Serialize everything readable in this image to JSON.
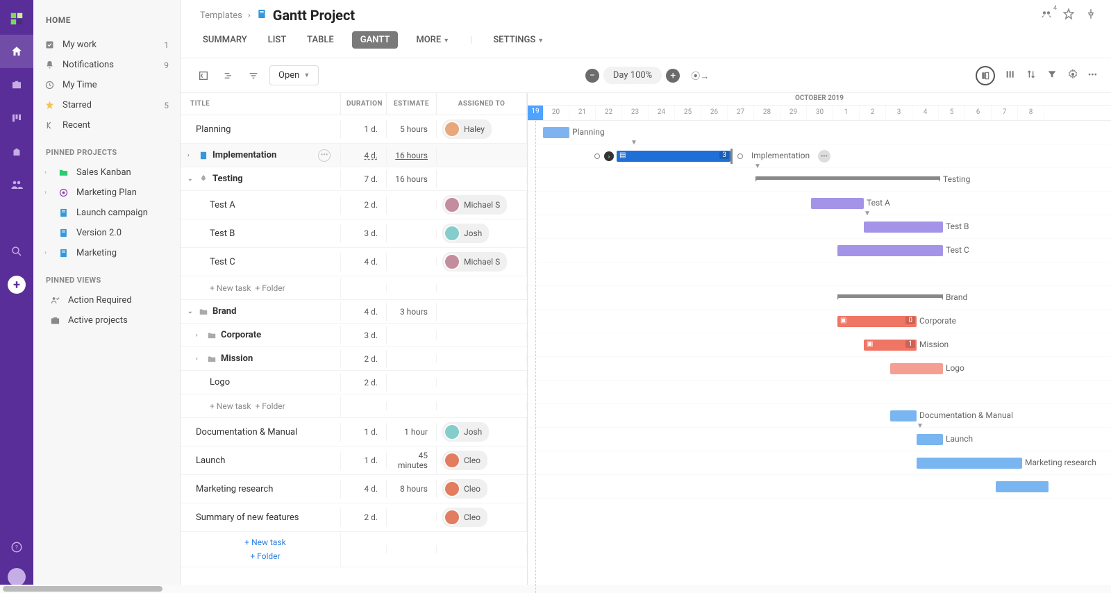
{
  "sidebar": {
    "title": "HOME",
    "nav": [
      {
        "icon": "check",
        "label": "My work",
        "count": "1"
      },
      {
        "icon": "bell",
        "label": "Notifications",
        "count": "9"
      },
      {
        "icon": "clock",
        "label": "My Time",
        "count": ""
      },
      {
        "icon": "star",
        "label": "Starred",
        "count": "5"
      },
      {
        "icon": "recent",
        "label": "Recent",
        "count": ""
      }
    ],
    "projects_label": "PINNED PROJECTS",
    "projects": [
      {
        "icon": "folder",
        "color": "green",
        "label": "Sales Kanban",
        "caret": true
      },
      {
        "icon": "target",
        "color": "purple",
        "label": "Marketing Plan",
        "caret": true
      },
      {
        "icon": "doc",
        "color": "blue",
        "label": "Launch campaign",
        "caret": false
      },
      {
        "icon": "doc",
        "color": "blue",
        "label": "Version 2.0",
        "caret": false
      },
      {
        "icon": "doc",
        "color": "blue",
        "label": "Marketing",
        "caret": true
      }
    ],
    "views_label": "PINNED VIEWS",
    "views": [
      {
        "icon": "user-check",
        "label": "Action Required"
      },
      {
        "icon": "briefcase",
        "label": "Active projects"
      }
    ]
  },
  "header": {
    "breadcrumb_root": "Templates",
    "title": "Gantt Project",
    "share_count": "4"
  },
  "tabs": {
    "summary": "SUMMARY",
    "list": "LIST",
    "table": "TABLE",
    "gantt": "GANTT",
    "more": "MORE",
    "settings": "SETTINGS"
  },
  "toolbar": {
    "open": "Open",
    "zoom": "Day 100%"
  },
  "columns": {
    "title": "TITLE",
    "duration": "DURATION",
    "estimate": "ESTIMATE",
    "assigned": "ASSIGNED TO"
  },
  "rows": {
    "planning": {
      "title": "Planning",
      "dur": "1 d.",
      "est": "5 hours",
      "assignee": "Haley"
    },
    "implementation": {
      "title": "Implementation",
      "dur": "4 d.",
      "est": "16 hours"
    },
    "testing": {
      "title": "Testing",
      "dur": "7 d.",
      "est": "16 hours"
    },
    "test_a": {
      "title": "Test A",
      "dur": "2 d.",
      "assignee": "Michael S"
    },
    "test_b": {
      "title": "Test B",
      "dur": "3 d.",
      "assignee": "Josh"
    },
    "test_c": {
      "title": "Test C",
      "dur": "4 d.",
      "assignee": "Michael S"
    },
    "brand": {
      "title": "Brand",
      "dur": "4 d.",
      "est": "3 hours"
    },
    "corporate": {
      "title": "Corporate",
      "dur": "3 d."
    },
    "mission": {
      "title": "Mission",
      "dur": "2 d."
    },
    "logo": {
      "title": "Logo",
      "dur": "2 d."
    },
    "docs": {
      "title": "Documentation & Manual",
      "dur": "1 d.",
      "est": "1 hour",
      "assignee": "Josh"
    },
    "launch": {
      "title": "Launch",
      "dur": "1 d.",
      "est": "45 minutes",
      "assignee": "Cleo"
    },
    "research": {
      "title": "Marketing research",
      "dur": "4 d.",
      "est": "8 hours",
      "assignee": "Cleo"
    },
    "summary": {
      "title": "Summary of new features",
      "dur": "2 d.",
      "assignee": "Cleo"
    }
  },
  "actions": {
    "new_task": "+ New task",
    "new_folder": "+ Folder"
  },
  "gantt": {
    "month": "OCTOBER 2019",
    "today": "19",
    "days": [
      "20",
      "21",
      "22",
      "23",
      "24",
      "25",
      "26",
      "27",
      "28",
      "29",
      "30",
      "1",
      "2",
      "3",
      "4",
      "5",
      "6",
      "7",
      "8"
    ],
    "impl_badge": "3",
    "corp_badge": "0",
    "mission_badge": "1",
    "labels": {
      "planning": "Planning",
      "implementation": "Implementation",
      "testing": "Testing",
      "test_a": "Test A",
      "test_b": "Test B",
      "test_c": "Test C",
      "brand": "Brand",
      "corporate": "Corporate",
      "mission": "Mission",
      "logo": "Logo",
      "docs": "Documentation & Manual",
      "launch": "Launch",
      "research": "Marketing research"
    }
  }
}
